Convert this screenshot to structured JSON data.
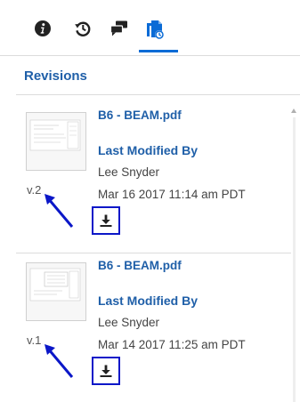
{
  "tabs": [
    {
      "icon": "info-icon",
      "label": ""
    },
    {
      "icon": "history-icon",
      "label": ""
    },
    {
      "icon": "comments-icon",
      "label": ""
    },
    {
      "icon": "revisions-icon",
      "label": "",
      "active": true
    }
  ],
  "section": {
    "title": "Revisions"
  },
  "revisions": [
    {
      "version": "v.2",
      "file_name": "B6 - BEAM.pdf",
      "modified_label": "Last Modified By",
      "modified_by": "Lee Snyder",
      "modified_date": "Mar 16 2017 11:14 am PDT",
      "download_icon": "download-icon"
    },
    {
      "version": "v.1",
      "file_name": "B6 - BEAM.pdf",
      "modified_label": "Last Modified By",
      "modified_by": "Lee Snyder",
      "modified_date": "Mar 14 2017 11:25 am PDT",
      "download_icon": "download-icon"
    }
  ],
  "colors": {
    "accent": "#1f5fa8",
    "active_tab_underline": "#0a6bd6",
    "annotation": "#0b17c8"
  }
}
